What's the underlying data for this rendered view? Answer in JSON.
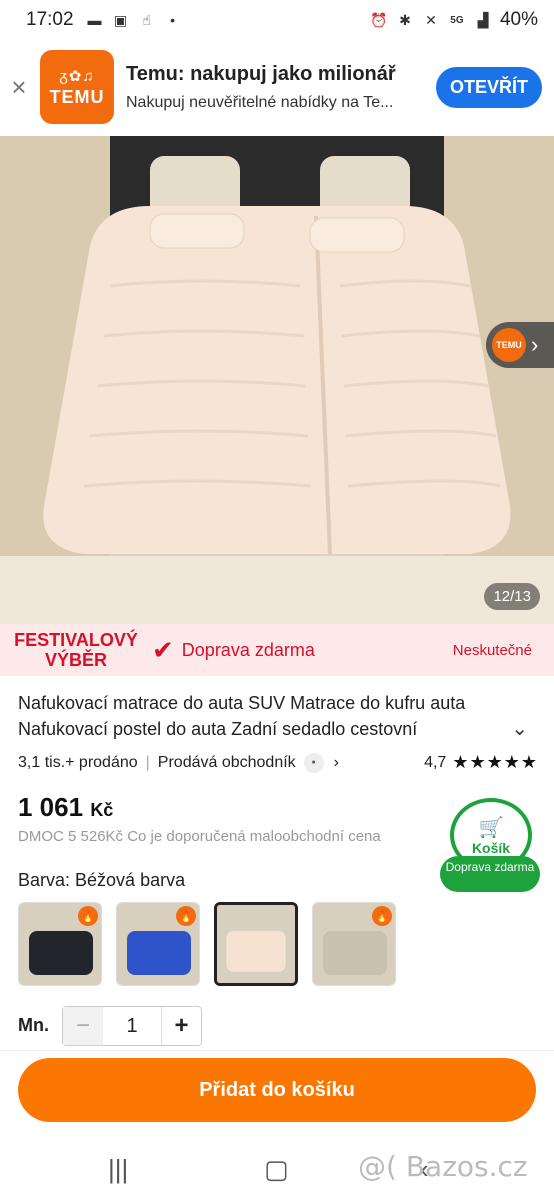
{
  "status_bar": {
    "time": "17:02",
    "battery": "40%",
    "network": "5G"
  },
  "banner": {
    "app_title": "Temu: nakupuj jako milionář",
    "app_subtitle": "Nakupuj neuvěřitelné nabídky na Te...",
    "logo_text": "TEMU",
    "open_label": "OTEVŘÍT"
  },
  "gallery": {
    "counter": "12/13",
    "badge_text": "TEMU"
  },
  "promo": {
    "tag_line1": "FESTIVALOVÝ",
    "tag_line2": "VÝBĚR",
    "shipping": "Doprava zdarma",
    "amazing": "Neskutečné"
  },
  "product": {
    "title": "Nafukovací matrace do auta SUV Matrace do kufru auta Nafukovací postel do auta Zadní sedadlo cestovní",
    "sold": "3,1 tis.+ prodáno",
    "seller": "Prodává obchodník",
    "rating": "4,7",
    "stars": "★★★★★",
    "price": "1 061",
    "currency": "Kč",
    "rrp": "DMOC 5 526Kč Co je doporučená maloobchodní cena",
    "color_label": "Barva: Béžová barva",
    "quantity_label": "Mn.",
    "quantity": "1"
  },
  "cart": {
    "label": "Košík",
    "pill": "Doprava zdarma"
  },
  "cta": {
    "add_to_cart": "Přidat do košíku"
  },
  "watermark": "@( Bazos.cz",
  "colors": {
    "accent": "#fb7701",
    "brand": "#f26b0f",
    "promo_red": "#d6112a",
    "cart_green": "#1ea33c",
    "open_blue": "#1a73e8"
  }
}
